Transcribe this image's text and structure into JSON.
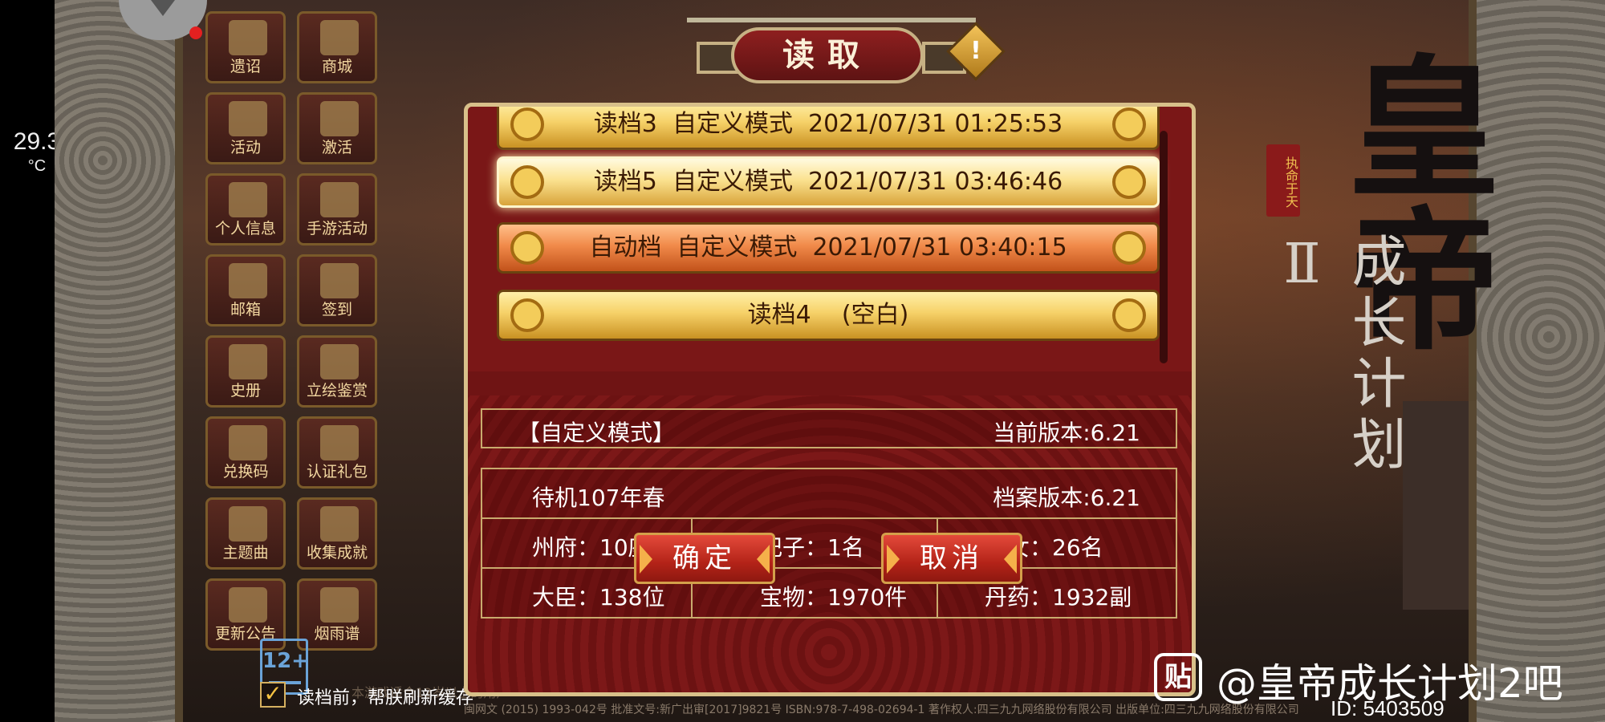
{
  "status": {
    "temperature_value": "29.3",
    "temperature_unit": "°C"
  },
  "menu": [
    {
      "label": "遗诏",
      "icon": "edict-icon"
    },
    {
      "label": "商城",
      "icon": "palace-icon"
    },
    {
      "label": "活动",
      "icon": "drum-icon"
    },
    {
      "label": "激活",
      "icon": "key-icon"
    },
    {
      "label": "个人信息",
      "icon": "profile-icon"
    },
    {
      "label": "手游活动",
      "icon": "phone-icon"
    },
    {
      "label": "邮箱",
      "icon": "mail-icon"
    },
    {
      "label": "签到",
      "icon": "signin-icon"
    },
    {
      "label": "史册",
      "icon": "book-icon"
    },
    {
      "label": "立绘鉴赏",
      "icon": "portrait-icon"
    },
    {
      "label": "兑换码",
      "icon": "code-icon"
    },
    {
      "label": "认证礼包",
      "icon": "certificate-icon"
    },
    {
      "label": "主题曲",
      "icon": "music-icon"
    },
    {
      "label": "收集成就",
      "icon": "achievement-icon"
    },
    {
      "label": "更新公告",
      "icon": "update-icon"
    },
    {
      "label": "烟雨谱",
      "icon": "scroll-icon"
    }
  ],
  "rating": "12+",
  "dialog": {
    "title": "读取",
    "warning_icon": "!",
    "save_slots": [
      {
        "text": "读档3  自定义模式  2021/07/31 01:25:53",
        "state": "normal"
      },
      {
        "text": "读档5  自定义模式  2021/07/31 03:46:46",
        "state": "selected"
      },
      {
        "text": "自动档  自定义模式  2021/07/31 03:40:15",
        "state": "auto"
      },
      {
        "text": "读档4    (空白)",
        "state": "normal"
      }
    ],
    "info": {
      "mode": "【自定义模式】",
      "current_version": "当前版本:6.21",
      "date": "待机107年春",
      "save_version": "档案版本:6.21",
      "prefectures": "州府：10座",
      "consorts": "妃子：1名",
      "children": "子女：26名",
      "ministers": "大臣：138位",
      "treasures": "宝物：1970件",
      "pills": "丹药：1932副"
    },
    "confirm_label": "确定",
    "cancel_label": "取消"
  },
  "refresh_cache": {
    "label": "读档前，帮朕刷新缓存",
    "checked": "✓"
  },
  "footer": {
    "faint": "本游戏适合12岁以上的用户",
    "legal": "闽网文 (2015) 1993-042号  批准文号:新广出审[2017]9821号  ISBN:978-7-498-02694-1  著作权人:四三九九网络股份有限公司 出版单位:四三九九网络股份有限公司"
  },
  "logo": {
    "title": "皇帝",
    "subtitle": "成长计划Ⅱ",
    "seal": "执命于天"
  },
  "watermark": {
    "icon": "贴",
    "text": "@皇帝成长计划2吧",
    "id": "ID: 5403509"
  }
}
